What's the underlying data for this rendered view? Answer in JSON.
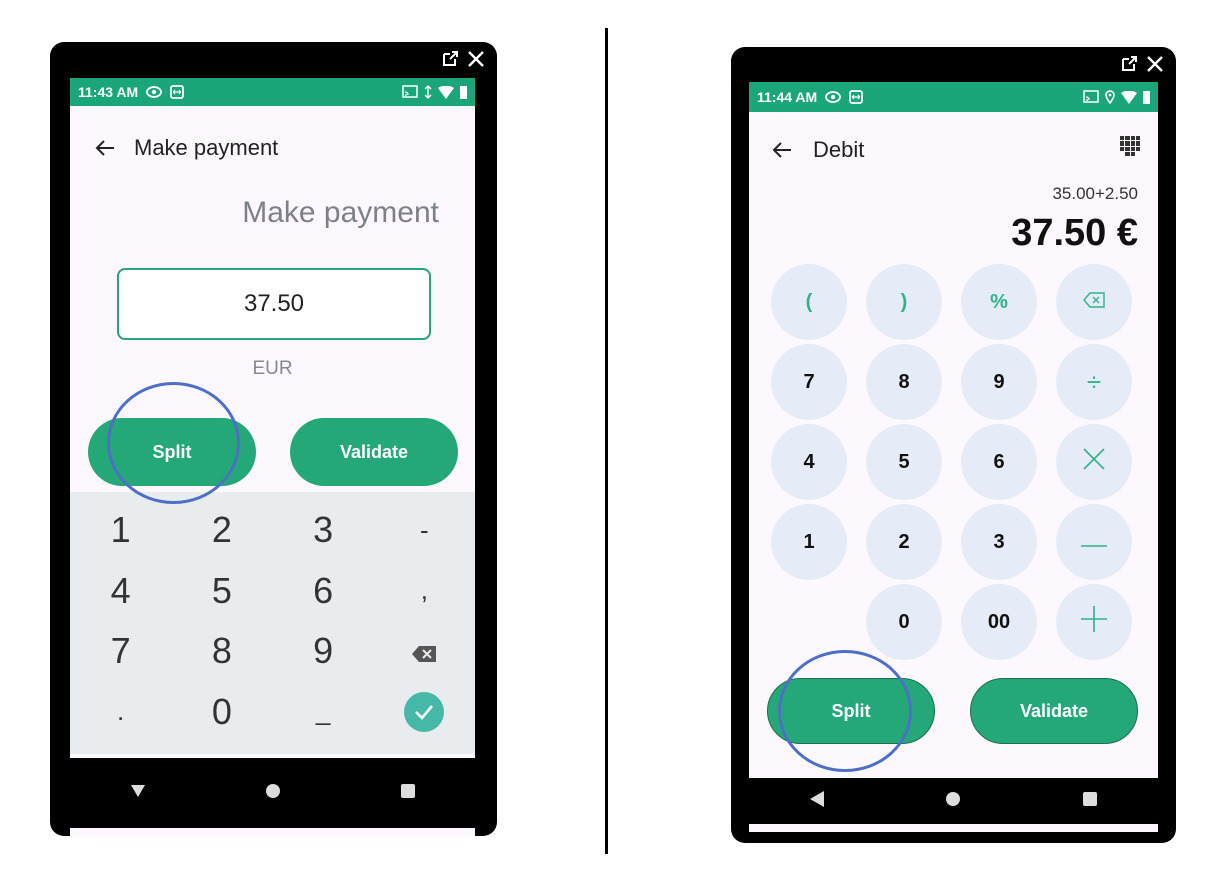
{
  "left": {
    "status": {
      "time": "11:43 AM"
    },
    "appbar_title": "Make payment",
    "heading": "Make payment",
    "amount_value": "37.50",
    "currency": "EUR",
    "buttons": {
      "split": "Split",
      "validate": "Validate"
    },
    "keyboard": {
      "keys": [
        "1",
        "2",
        "3",
        "-",
        "4",
        "5",
        "6",
        ",",
        "7",
        "8",
        "9",
        "backspace-icon",
        ".",
        "0",
        "_",
        "check-icon"
      ]
    }
  },
  "right": {
    "status": {
      "time": "11:44 AM"
    },
    "appbar_title": "Debit",
    "expression": "35.00+2.50",
    "total": "37.50 €",
    "keys": {
      "open_paren": "(",
      "close_paren": ")",
      "percent": "%",
      "seven": "7",
      "eight": "8",
      "nine": "9",
      "divide": "÷",
      "four": "4",
      "five": "5",
      "six": "6",
      "one": "1",
      "two": "2",
      "three": "3",
      "zero": "0",
      "double_zero": "00"
    },
    "buttons": {
      "split": "Split",
      "validate": "Validate"
    }
  },
  "colors": {
    "accent": "#24a878",
    "status_bar": "#1aa57a",
    "highlight_circle": "#4e6fc7",
    "key_bg": "#e6ecf7"
  }
}
